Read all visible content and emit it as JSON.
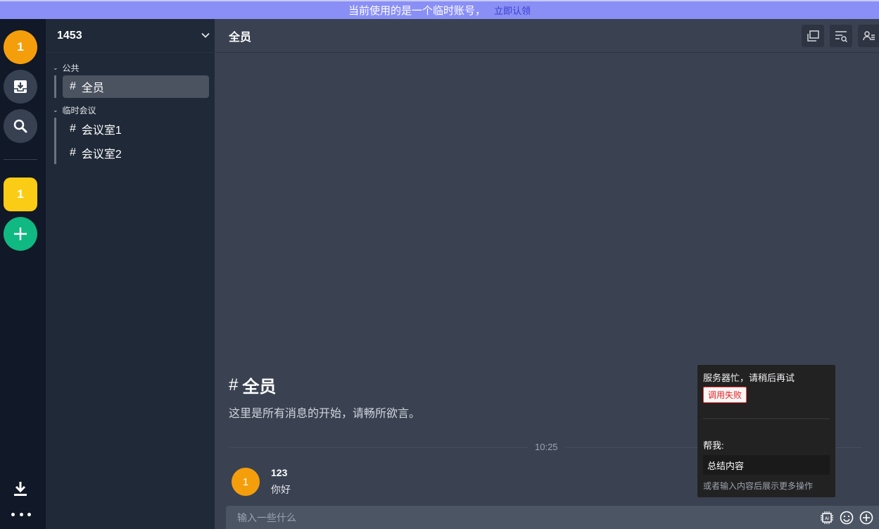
{
  "banner": {
    "text": "当前使用的是一个临时账号，",
    "link": "立即认领"
  },
  "rail": {
    "avatar_label": "1",
    "group_label": "1"
  },
  "sidebar": {
    "server_name": "1453",
    "sections": [
      {
        "title": "公共",
        "channels": [
          "全员"
        ]
      },
      {
        "title": "临时会议",
        "channels": [
          "会议室1",
          "会议室2"
        ]
      }
    ]
  },
  "main": {
    "channel_title": "全员",
    "welcome_title": "全员",
    "welcome_sub": "这里是所有消息的开始，请畅所欲言。",
    "time_divider": "10:25",
    "message": {
      "avatar": "1",
      "author": "123",
      "text": "你好"
    },
    "composer_placeholder": "输入一些什么"
  },
  "popup": {
    "busy": "服务器忙，请稍后再试",
    "fail_badge": "调用失败",
    "help_label": "帮我:",
    "summary_option": "总结内容",
    "hint": "或者输入内容后展示更多操作"
  },
  "colors": {
    "banner": "#8a8ff5",
    "avatar": "#f59e0b",
    "group": "#facc15",
    "add": "#10b981",
    "rail": "#111827",
    "sidebar": "#1f2937",
    "main": "#3a4252"
  }
}
